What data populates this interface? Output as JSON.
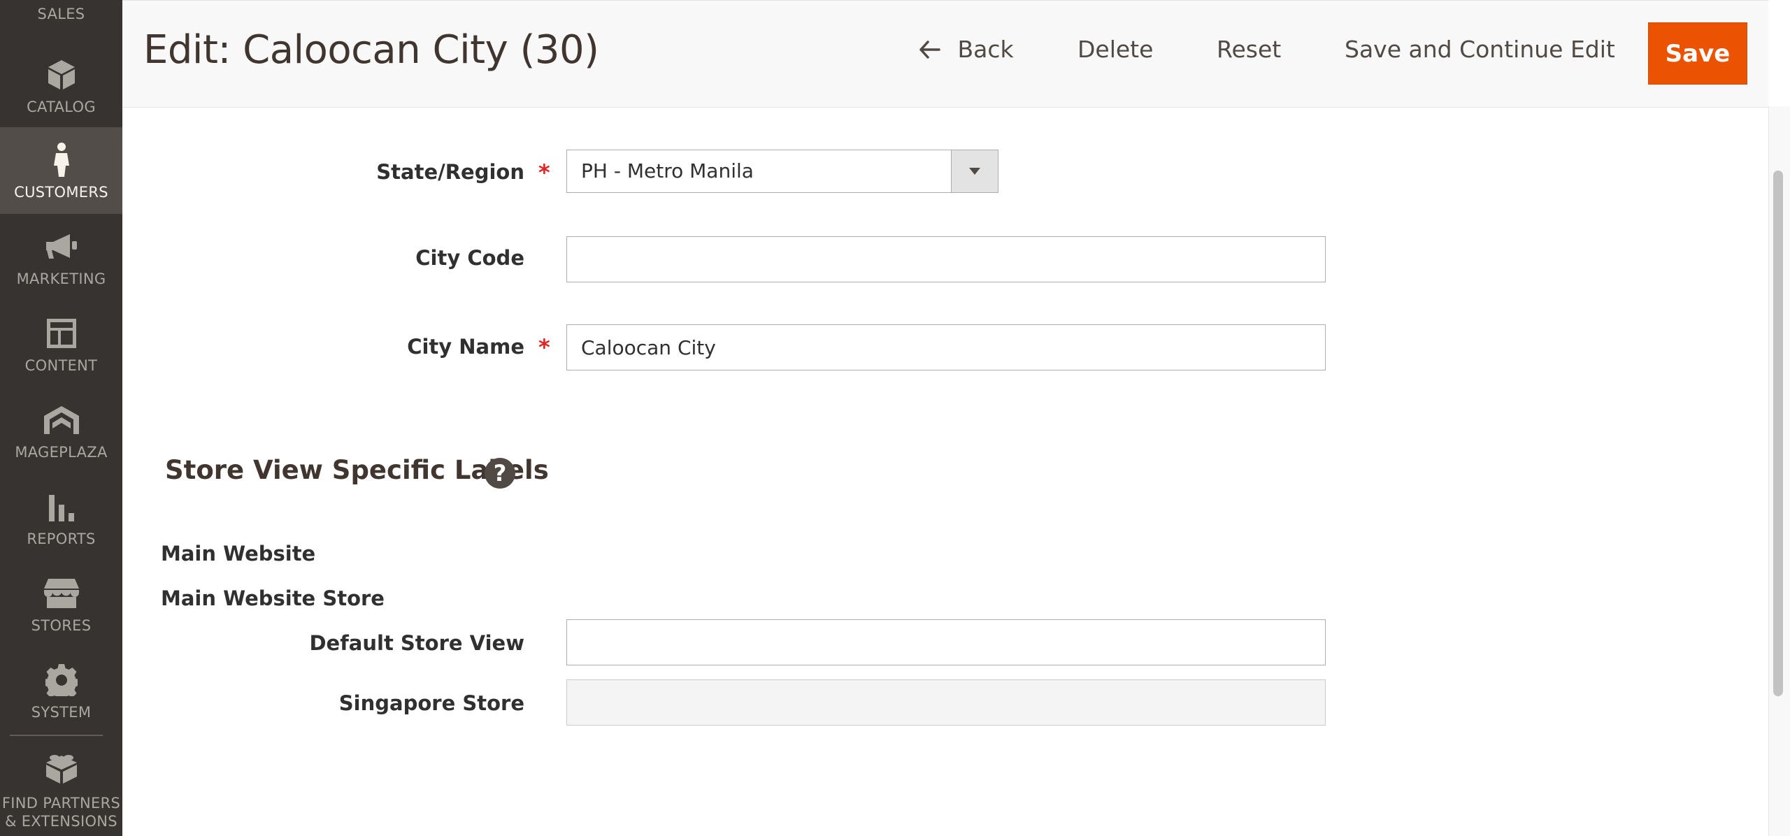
{
  "sidebar": {
    "sales_label": "SALES",
    "items": [
      {
        "label": "CATALOG",
        "icon": "cube-icon"
      },
      {
        "label": "CUSTOMERS",
        "icon": "person-icon",
        "active": true
      },
      {
        "label": "MARKETING",
        "icon": "megaphone-icon"
      },
      {
        "label": "CONTENT",
        "icon": "layout-icon"
      },
      {
        "label": "MAGEPLAZA",
        "icon": "mageplaza-logo-icon"
      },
      {
        "label": "REPORTS",
        "icon": "bar-chart-icon"
      },
      {
        "label": "STORES",
        "icon": "storefront-icon"
      },
      {
        "label": "SYSTEM",
        "icon": "gear-icon"
      }
    ],
    "partners_line1": "FIND PARTNERS",
    "partners_line2": "& EXTENSIONS"
  },
  "header": {
    "title": "Edit: Caloocan City (30)",
    "back_label": "Back",
    "delete_label": "Delete",
    "reset_label": "Reset",
    "save_continue_label": "Save and Continue Edit",
    "save_label": "Save"
  },
  "form": {
    "state_region_label": "State/Region",
    "state_region_value": "PH - Metro Manila",
    "city_code_label": "City Code",
    "city_code_value": "",
    "city_name_label": "City Name",
    "city_name_value": "Caloocan City",
    "required_marker": "*"
  },
  "store_labels": {
    "section_title": "Store View Specific Labels",
    "help_symbol": "?",
    "website_label": "Main Website",
    "store_label": "Main Website Store",
    "default_view_label": "Default Store View",
    "default_view_value": "",
    "singapore_label": "Singapore Store",
    "singapore_value": ""
  },
  "colors": {
    "sidebar_bg": "#373330",
    "sidebar_active_bg": "#524d49",
    "save_button_bg": "#eb5202",
    "required_star": "#e22626"
  }
}
